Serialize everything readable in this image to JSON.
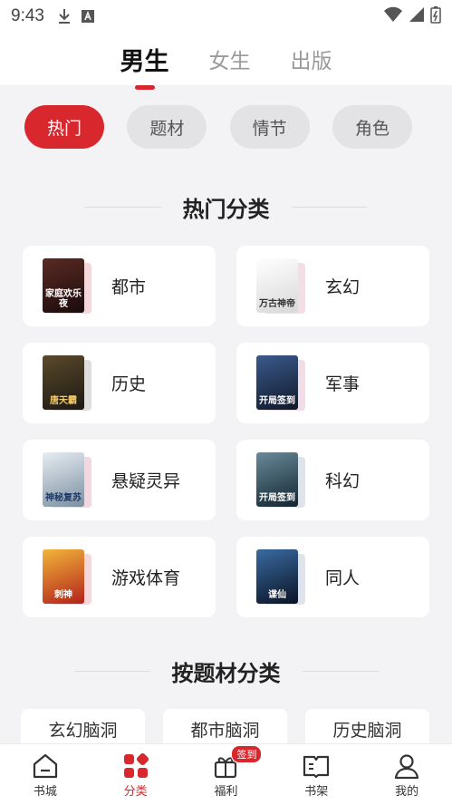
{
  "status_bar": {
    "time": "9:43"
  },
  "top_tabs": [
    {
      "label": "男生",
      "active": true
    },
    {
      "label": "女生",
      "active": false
    },
    {
      "label": "出版",
      "active": false
    }
  ],
  "chips": [
    {
      "label": "热门",
      "active": true
    },
    {
      "label": "题材",
      "active": false
    },
    {
      "label": "情节",
      "active": false
    },
    {
      "label": "角色",
      "active": false
    }
  ],
  "hot_section": {
    "title": "热门分类"
  },
  "categories": [
    {
      "label": "都市",
      "cover_text": "家庭欢乐夜",
      "cover_color": "#3a1a1a"
    },
    {
      "label": "玄幻",
      "cover_text": "万古神帝",
      "cover_color": "#f0f0f0"
    },
    {
      "label": "历史",
      "cover_text": "唐天霸",
      "cover_color": "#2d2a22"
    },
    {
      "label": "军事",
      "cover_text": "开局签到",
      "cover_color": "#1e2a44"
    },
    {
      "label": "悬疑灵异",
      "cover_text": "神秘复苏",
      "cover_color": "#c9d6e0"
    },
    {
      "label": "科幻",
      "cover_text": "开局签到",
      "cover_color": "#1f3a4a"
    },
    {
      "label": "游戏体育",
      "cover_text": "刺神",
      "cover_color": "#c7401f"
    },
    {
      "label": "同人",
      "cover_text": "谍仙",
      "cover_color": "#0e1f3a"
    }
  ],
  "theme_section": {
    "title": "按题材分类"
  },
  "sub_categories": [
    "玄幻脑洞",
    "都市脑洞",
    "历史脑洞"
  ],
  "bottom_nav": [
    {
      "label": "书城",
      "icon": "home-icon",
      "active": false
    },
    {
      "label": "分类",
      "icon": "category-icon",
      "active": true
    },
    {
      "label": "福利",
      "icon": "gift-icon",
      "active": false,
      "badge": "签到"
    },
    {
      "label": "书架",
      "icon": "bookshelf-icon",
      "active": false
    },
    {
      "label": "我的",
      "icon": "profile-icon",
      "active": false
    }
  ],
  "colors": {
    "accent": "#d9272e",
    "background": "#f3f3f5"
  }
}
